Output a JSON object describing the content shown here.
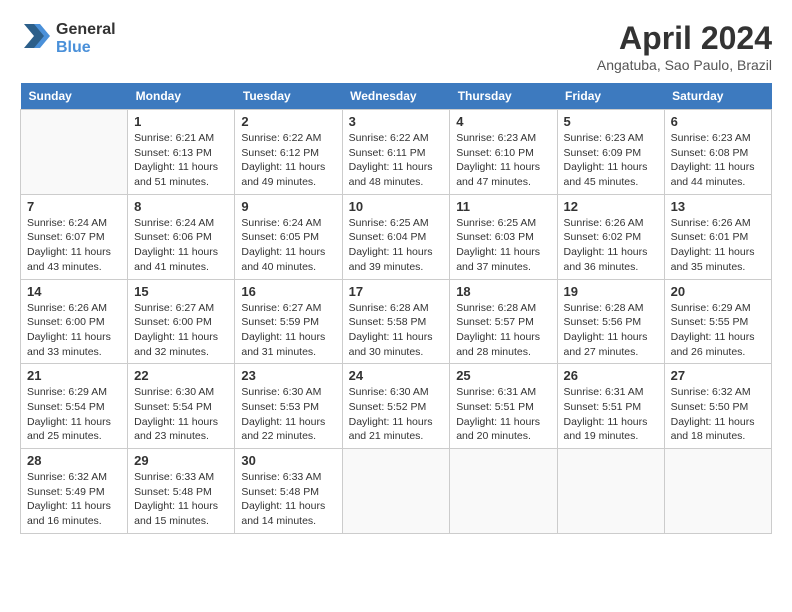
{
  "logo": {
    "line1": "General",
    "line2": "Blue"
  },
  "title": "April 2024",
  "location": "Angatuba, Sao Paulo, Brazil",
  "days_header": [
    "Sunday",
    "Monday",
    "Tuesday",
    "Wednesday",
    "Thursday",
    "Friday",
    "Saturday"
  ],
  "weeks": [
    [
      {
        "day": "",
        "info": ""
      },
      {
        "day": "1",
        "info": "Sunrise: 6:21 AM\nSunset: 6:13 PM\nDaylight: 11 hours\nand 51 minutes."
      },
      {
        "day": "2",
        "info": "Sunrise: 6:22 AM\nSunset: 6:12 PM\nDaylight: 11 hours\nand 49 minutes."
      },
      {
        "day": "3",
        "info": "Sunrise: 6:22 AM\nSunset: 6:11 PM\nDaylight: 11 hours\nand 48 minutes."
      },
      {
        "day": "4",
        "info": "Sunrise: 6:23 AM\nSunset: 6:10 PM\nDaylight: 11 hours\nand 47 minutes."
      },
      {
        "day": "5",
        "info": "Sunrise: 6:23 AM\nSunset: 6:09 PM\nDaylight: 11 hours\nand 45 minutes."
      },
      {
        "day": "6",
        "info": "Sunrise: 6:23 AM\nSunset: 6:08 PM\nDaylight: 11 hours\nand 44 minutes."
      }
    ],
    [
      {
        "day": "7",
        "info": "Sunrise: 6:24 AM\nSunset: 6:07 PM\nDaylight: 11 hours\nand 43 minutes."
      },
      {
        "day": "8",
        "info": "Sunrise: 6:24 AM\nSunset: 6:06 PM\nDaylight: 11 hours\nand 41 minutes."
      },
      {
        "day": "9",
        "info": "Sunrise: 6:24 AM\nSunset: 6:05 PM\nDaylight: 11 hours\nand 40 minutes."
      },
      {
        "day": "10",
        "info": "Sunrise: 6:25 AM\nSunset: 6:04 PM\nDaylight: 11 hours\nand 39 minutes."
      },
      {
        "day": "11",
        "info": "Sunrise: 6:25 AM\nSunset: 6:03 PM\nDaylight: 11 hours\nand 37 minutes."
      },
      {
        "day": "12",
        "info": "Sunrise: 6:26 AM\nSunset: 6:02 PM\nDaylight: 11 hours\nand 36 minutes."
      },
      {
        "day": "13",
        "info": "Sunrise: 6:26 AM\nSunset: 6:01 PM\nDaylight: 11 hours\nand 35 minutes."
      }
    ],
    [
      {
        "day": "14",
        "info": "Sunrise: 6:26 AM\nSunset: 6:00 PM\nDaylight: 11 hours\nand 33 minutes."
      },
      {
        "day": "15",
        "info": "Sunrise: 6:27 AM\nSunset: 6:00 PM\nDaylight: 11 hours\nand 32 minutes."
      },
      {
        "day": "16",
        "info": "Sunrise: 6:27 AM\nSunset: 5:59 PM\nDaylight: 11 hours\nand 31 minutes."
      },
      {
        "day": "17",
        "info": "Sunrise: 6:28 AM\nSunset: 5:58 PM\nDaylight: 11 hours\nand 30 minutes."
      },
      {
        "day": "18",
        "info": "Sunrise: 6:28 AM\nSunset: 5:57 PM\nDaylight: 11 hours\nand 28 minutes."
      },
      {
        "day": "19",
        "info": "Sunrise: 6:28 AM\nSunset: 5:56 PM\nDaylight: 11 hours\nand 27 minutes."
      },
      {
        "day": "20",
        "info": "Sunrise: 6:29 AM\nSunset: 5:55 PM\nDaylight: 11 hours\nand 26 minutes."
      }
    ],
    [
      {
        "day": "21",
        "info": "Sunrise: 6:29 AM\nSunset: 5:54 PM\nDaylight: 11 hours\nand 25 minutes."
      },
      {
        "day": "22",
        "info": "Sunrise: 6:30 AM\nSunset: 5:54 PM\nDaylight: 11 hours\nand 23 minutes."
      },
      {
        "day": "23",
        "info": "Sunrise: 6:30 AM\nSunset: 5:53 PM\nDaylight: 11 hours\nand 22 minutes."
      },
      {
        "day": "24",
        "info": "Sunrise: 6:30 AM\nSunset: 5:52 PM\nDaylight: 11 hours\nand 21 minutes."
      },
      {
        "day": "25",
        "info": "Sunrise: 6:31 AM\nSunset: 5:51 PM\nDaylight: 11 hours\nand 20 minutes."
      },
      {
        "day": "26",
        "info": "Sunrise: 6:31 AM\nSunset: 5:51 PM\nDaylight: 11 hours\nand 19 minutes."
      },
      {
        "day": "27",
        "info": "Sunrise: 6:32 AM\nSunset: 5:50 PM\nDaylight: 11 hours\nand 18 minutes."
      }
    ],
    [
      {
        "day": "28",
        "info": "Sunrise: 6:32 AM\nSunset: 5:49 PM\nDaylight: 11 hours\nand 16 minutes."
      },
      {
        "day": "29",
        "info": "Sunrise: 6:33 AM\nSunset: 5:48 PM\nDaylight: 11 hours\nand 15 minutes."
      },
      {
        "day": "30",
        "info": "Sunrise: 6:33 AM\nSunset: 5:48 PM\nDaylight: 11 hours\nand 14 minutes."
      },
      {
        "day": "",
        "info": ""
      },
      {
        "day": "",
        "info": ""
      },
      {
        "day": "",
        "info": ""
      },
      {
        "day": "",
        "info": ""
      }
    ]
  ]
}
